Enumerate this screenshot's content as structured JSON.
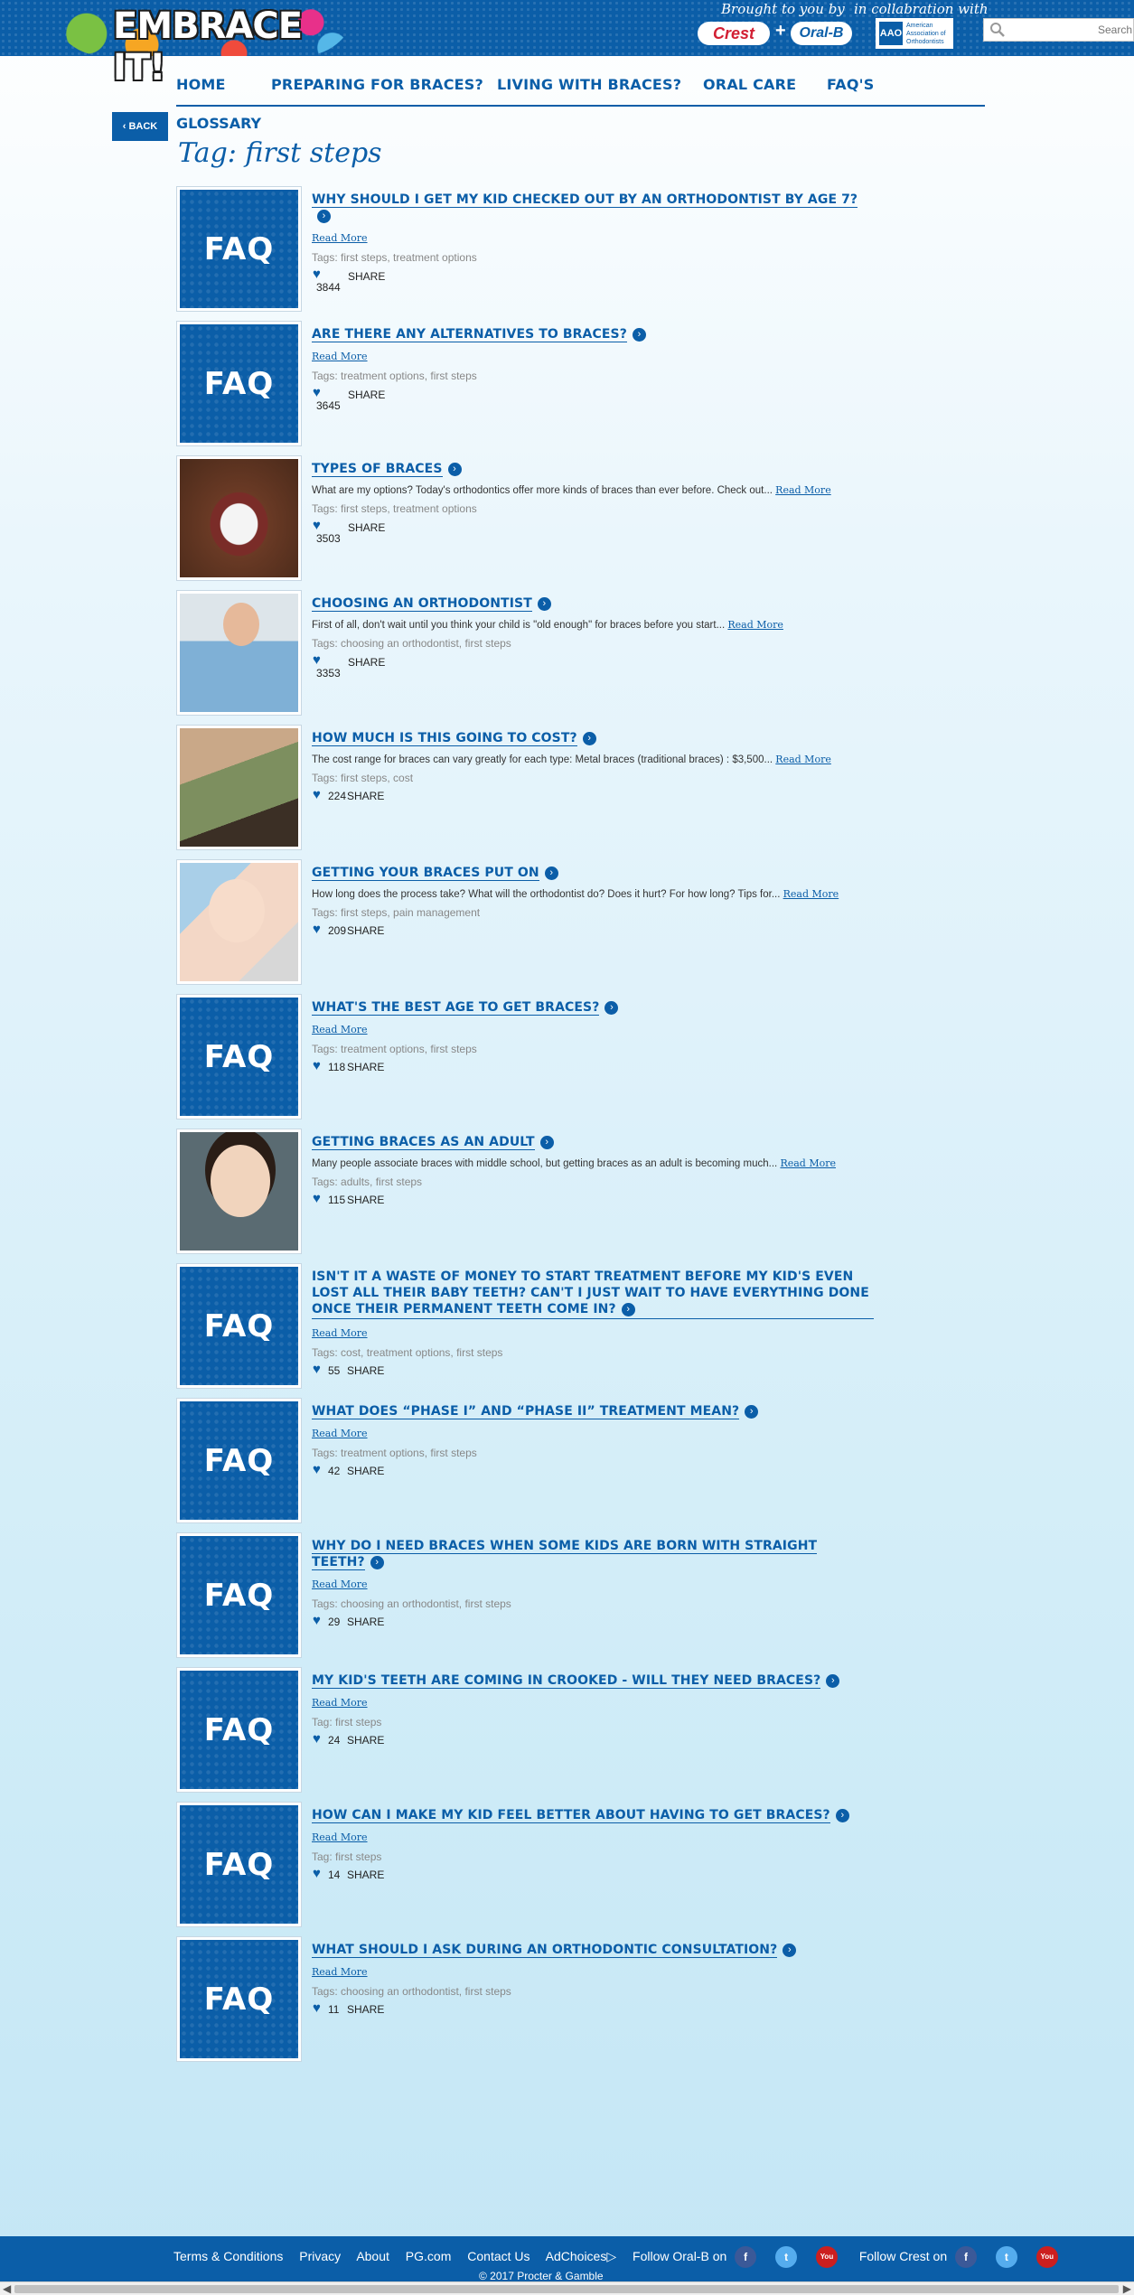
{
  "header": {
    "logo_text": "EMBRACE IT!",
    "brought_by": "Brought to you by",
    "collab": "in collabration with",
    "crest": "Crest",
    "plus": "+",
    "oralb": "Oral-B",
    "aao_mark": "AAO",
    "aao_text": "American Association of Orthodontists",
    "search_placeholder": "Search"
  },
  "nav": {
    "home": "HOME",
    "preparing": "PREPARING FOR BRACES?",
    "living": "LIVING WITH BRACES?",
    "oral_care": "ORAL CARE",
    "faqs": "FAQ'S"
  },
  "back_label": "‹ BACK",
  "glossary": "GLOSSARY",
  "page_title": "Tag: first steps",
  "faq_label": "FAQ",
  "share_label": "SHARE",
  "read_more": "Read More",
  "arrow": "›",
  "heart": "♥",
  "items": [
    {
      "title": "WHY SHOULD I GET MY KID CHECKED OUT BY AN ORTHODONTIST BY AGE 7?",
      "excerpt": "",
      "tags": "Tags: first steps, treatment options",
      "likes": "3844"
    },
    {
      "title": "ARE THERE ANY ALTERNATIVES TO BRACES?",
      "excerpt": "",
      "tags": "Tags: treatment options, first steps",
      "likes": "3645"
    },
    {
      "title": "TYPES OF BRACES",
      "excerpt": "What are my options? Today's orthodontics offer more kinds of braces than ever before. Check out...",
      "tags": "Tags: first steps, treatment options",
      "likes": "3503"
    },
    {
      "title": "CHOOSING AN ORTHODONTIST",
      "excerpt": "First of all, don't wait until you think your child is \"old enough\" for braces before you start...",
      "tags": "Tags: choosing an orthodontist, first steps",
      "likes": "3353"
    },
    {
      "title": "HOW MUCH IS THIS GOING TO COST?",
      "excerpt": "The cost range for braces can vary greatly for each type: Metal braces (traditional braces) : $3,500...",
      "tags": "Tags: first steps, cost",
      "likes": "224"
    },
    {
      "title": "GETTING YOUR BRACES PUT ON",
      "excerpt": "How long does the process take? What will the orthodontist do? Does it hurt? For how long? Tips for...",
      "tags": "Tags: first steps, pain management",
      "likes": "209"
    },
    {
      "title": "WHAT'S THE BEST AGE TO GET BRACES?",
      "excerpt": "",
      "tags": "Tags: treatment options, first steps",
      "likes": "118"
    },
    {
      "title": "GETTING BRACES AS AN ADULT",
      "excerpt": "Many people associate braces with middle school, but getting braces as an adult is becoming much...",
      "tags": "Tags: adults, first steps",
      "likes": "115"
    },
    {
      "title": "ISN'T IT A WASTE OF MONEY TO START TREATMENT BEFORE MY KID'S EVEN LOST ALL THEIR BABY TEETH? CAN'T I JUST WAIT TO HAVE EVERYTHING DONE ONCE THEIR PERMANENT TEETH COME IN?",
      "excerpt": "",
      "tags": "Tags: cost, treatment options, first steps",
      "likes": "55"
    },
    {
      "title": "WHAT DOES “PHASE I” AND “PHASE II” TREATMENT MEAN?",
      "excerpt": "",
      "tags": "Tags: treatment options, first steps",
      "likes": "42"
    },
    {
      "title": "WHY DO I NEED BRACES WHEN SOME KIDS ARE BORN WITH STRAIGHT TEETH?",
      "excerpt": "",
      "tags": "Tags: choosing an orthodontist, first steps",
      "likes": "29"
    },
    {
      "title": "MY KID'S TEETH ARE COMING IN CROOKED - WILL THEY NEED BRACES?",
      "excerpt": "",
      "tags": "Tag: first steps",
      "likes": "24"
    },
    {
      "title": "HOW CAN I MAKE MY KID FEEL BETTER ABOUT HAVING TO GET BRACES?",
      "excerpt": "",
      "tags": "Tag: first steps",
      "likes": "14"
    },
    {
      "title": "WHAT SHOULD I ASK DURING AN ORTHODONTIC CONSULTATION?",
      "excerpt": "",
      "tags": "Tags: choosing an orthodontist, first steps",
      "likes": "11"
    }
  ],
  "footer": {
    "terms": "Terms & Conditions",
    "privacy": "Privacy",
    "about": "About",
    "pg": "PG.com",
    "contact": "Contact Us",
    "adchoices": "AdChoices▷",
    "follow_oralb": "Follow Oral-B on",
    "follow_crest": "Follow Crest on",
    "fb": "f",
    "tw": "t",
    "yt": "You",
    "copyright": "© 2017 Procter & Gamble"
  },
  "colors": {
    "brand_blue": "#0b5ea8"
  }
}
